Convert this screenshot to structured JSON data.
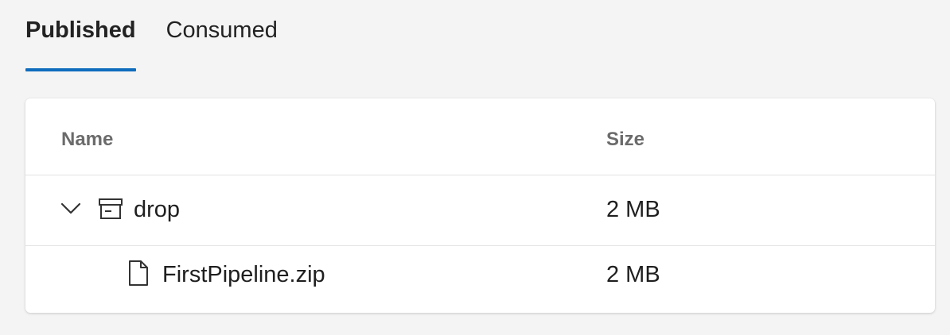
{
  "tabs": [
    {
      "label": "Published",
      "active": true
    },
    {
      "label": "Consumed",
      "active": false
    }
  ],
  "table": {
    "columns": {
      "name": "Name",
      "size": "Size"
    },
    "rows": [
      {
        "name": "drop",
        "size": "2 MB",
        "type": "folder",
        "expanded": true,
        "icon": "archive-icon"
      },
      {
        "name": "FirstPipeline.zip",
        "size": "2 MB",
        "type": "file",
        "icon": "file-icon"
      }
    ]
  },
  "colors": {
    "accent": "#0f6cbd",
    "background": "#f4f4f4",
    "card": "#ffffff",
    "header_text": "#6b6b6b"
  }
}
